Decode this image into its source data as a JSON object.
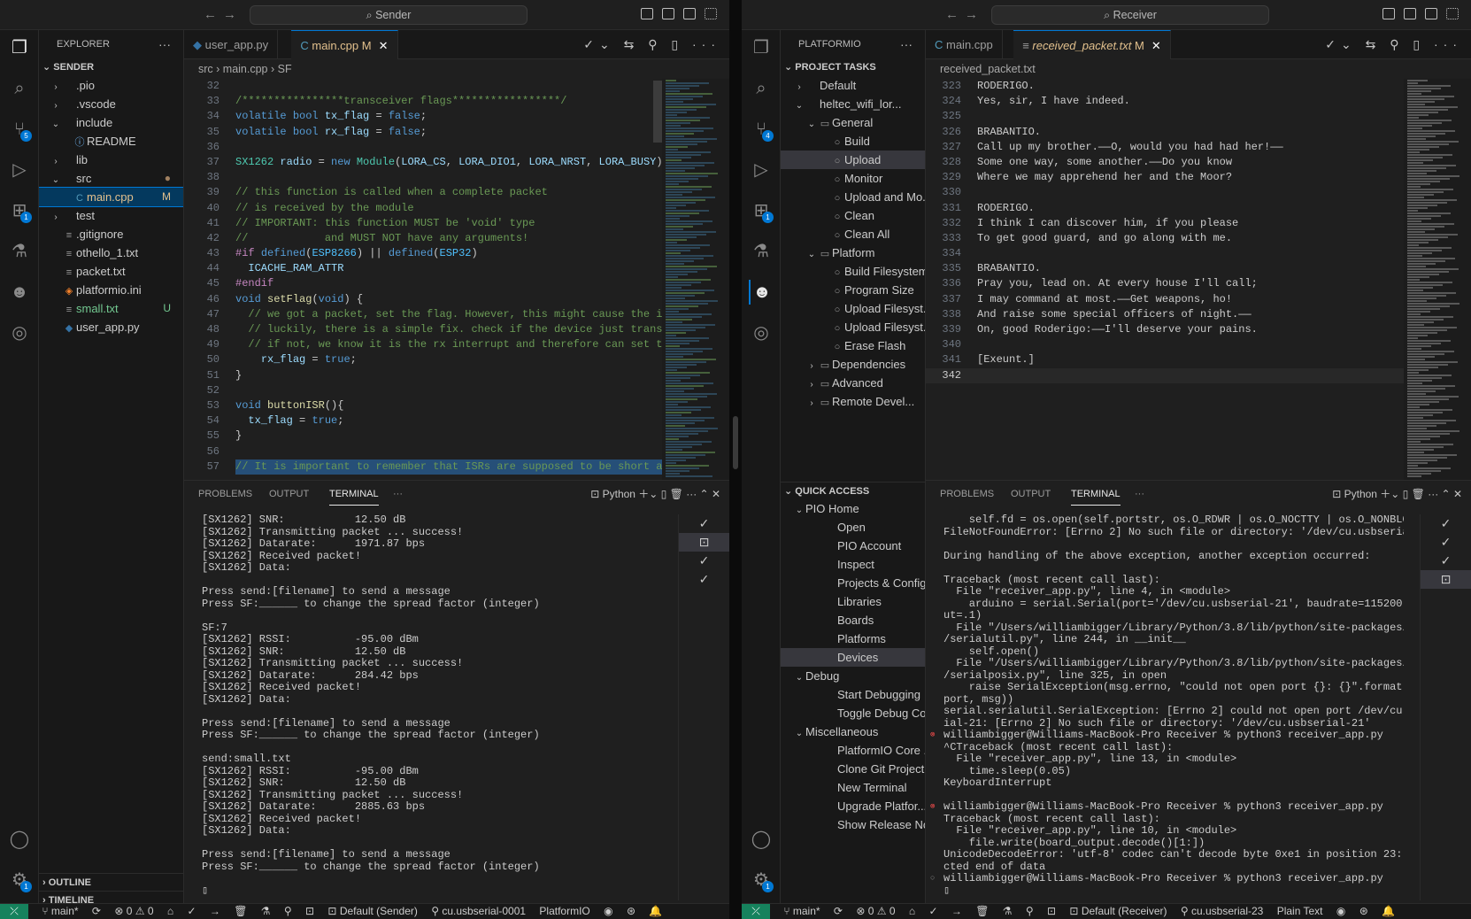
{
  "left": {
    "title": "Sender",
    "explorer_title": "EXPLORER",
    "root": "SENDER",
    "files": [
      {
        "name": ".pio",
        "type": "folder",
        "open": false,
        "indent": 1,
        "status": ""
      },
      {
        "name": ".vscode",
        "type": "folder",
        "open": false,
        "indent": 1,
        "status": ""
      },
      {
        "name": "include",
        "type": "folder",
        "open": true,
        "indent": 1,
        "status": ""
      },
      {
        "name": "README",
        "type": "info",
        "indent": 2,
        "status": ""
      },
      {
        "name": "lib",
        "type": "folder",
        "open": false,
        "indent": 1,
        "status": ""
      },
      {
        "name": "src",
        "type": "folder",
        "open": true,
        "indent": 1,
        "status": "●"
      },
      {
        "name": "main.cpp",
        "type": "cpp",
        "indent": 2,
        "status": "M",
        "selected": true
      },
      {
        "name": "test",
        "type": "folder",
        "open": false,
        "indent": 1,
        "status": ""
      },
      {
        "name": ".gitignore",
        "type": "text",
        "indent": 1,
        "status": ""
      },
      {
        "name": "othello_1.txt",
        "type": "text",
        "indent": 1,
        "status": ""
      },
      {
        "name": "packet.txt",
        "type": "text",
        "indent": 1,
        "status": ""
      },
      {
        "name": "platformio.ini",
        "type": "pio",
        "indent": 1,
        "status": ""
      },
      {
        "name": "small.txt",
        "type": "text",
        "indent": 1,
        "status": "U",
        "green": true
      },
      {
        "name": "user_app.py",
        "type": "py",
        "indent": 1,
        "status": ""
      }
    ],
    "outline": "OUTLINE",
    "timeline": "TIMELINE",
    "tabs": [
      {
        "name": "user_app.py",
        "active": false,
        "mod": ""
      },
      {
        "name": "main.cpp",
        "active": true,
        "mod": "M"
      }
    ],
    "breadcrumb": [
      "src",
      "main.cpp",
      "SF"
    ],
    "code": [
      {
        "n": "32",
        "t": ""
      },
      {
        "n": "33",
        "t": "/****************transceiver flags*****************/"
      },
      {
        "n": "34",
        "t": "volatile bool tx_flag = false;"
      },
      {
        "n": "35",
        "t": "volatile bool rx_flag = false;"
      },
      {
        "n": "36",
        "t": ""
      },
      {
        "n": "37",
        "t": "SX1262 radio = new Module(LORA_CS, LORA_DIO1, LORA_NRST, LORA_BUSY);"
      },
      {
        "n": "38",
        "t": ""
      },
      {
        "n": "39",
        "t": "// this function is called when a complete packet"
      },
      {
        "n": "40",
        "t": "// is received by the module"
      },
      {
        "n": "41",
        "t": "// IMPORTANT: this function MUST be 'void' type"
      },
      {
        "n": "42",
        "t": "//            and MUST NOT have any arguments!"
      },
      {
        "n": "43",
        "t": "#if defined(ESP8266) || defined(ESP32)"
      },
      {
        "n": "44",
        "t": "  ICACHE_RAM_ATTR"
      },
      {
        "n": "45",
        "t": "#endif"
      },
      {
        "n": "46",
        "t": "void setFlag(void) {"
      },
      {
        "n": "47",
        "t": "  // we got a packet, set the flag. However, this might cause the i"
      },
      {
        "n": "48",
        "t": "  // luckily, there is a simple fix. check if the device just trans"
      },
      {
        "n": "49",
        "t": "  // if not, we know it is the rx interrupt and therefore can set t"
      },
      {
        "n": "50",
        "t": "    rx_flag = true;"
      },
      {
        "n": "51",
        "t": "}"
      },
      {
        "n": "52",
        "t": ""
      },
      {
        "n": "53",
        "t": "void buttonISR(){"
      },
      {
        "n": "54",
        "t": "  tx_flag = true;"
      },
      {
        "n": "55",
        "t": "}"
      },
      {
        "n": "56",
        "t": ""
      },
      {
        "n": "57",
        "t": "// It is important to remember that ISRs are supposed to be short a"
      }
    ],
    "panel_tabs": [
      "PROBLEMS",
      "OUTPUT",
      "TERMINAL"
    ],
    "terminal_name": "Python",
    "terminal": [
      "[SX1262] SNR:           12.50 dB",
      "[SX1262] Transmitting packet ... success!",
      "[SX1262] Datarate:      1971.87 bps",
      "[SX1262] Received packet!",
      "[SX1262] Data:",
      "",
      "Press send:[filename] to send a message",
      "Press SF:______ to change the spread factor (integer)",
      "",
      "SF:7",
      "[SX1262] RSSI:          -95.00 dBm",
      "[SX1262] SNR:           12.50 dB",
      "[SX1262] Transmitting packet ... success!",
      "[SX1262] Datarate:      284.42 bps",
      "[SX1262] Received packet!",
      "[SX1262] Data:",
      "",
      "Press send:[filename] to send a message",
      "Press SF:______ to change the spread factor (integer)",
      "",
      "send:small.txt",
      "[SX1262] RSSI:          -95.00 dBm",
      "[SX1262] SNR:           12.50 dB",
      "[SX1262] Transmitting packet ... success!",
      "[SX1262] Datarate:      2885.63 bps",
      "[SX1262] Received packet!",
      "[SX1262] Data:",
      "",
      "Press send:[filename] to send a message",
      "Press SF:______ to change the spread factor (integer)",
      "",
      "▯"
    ],
    "status": {
      "branch": "main*",
      "problems": "⊗ 0 ⚠ 0",
      "env": "Default (Sender)",
      "port": "cu.usbserial-0001",
      "platform": "PlatformIO"
    }
  },
  "right": {
    "title": "Receiver",
    "sidebar_title": "PLATFORMIO",
    "project_tasks": "PROJECT TASKS",
    "tasks": [
      {
        "name": "Default",
        "type": "twisty-closed",
        "indent": 1
      },
      {
        "name": "heltec_wifi_lor...",
        "type": "twisty-open",
        "indent": 1
      },
      {
        "name": "General",
        "type": "folder-open",
        "indent": 2
      },
      {
        "name": "Build",
        "type": "task",
        "indent": 3
      },
      {
        "name": "Upload",
        "type": "task",
        "indent": 3,
        "selected": true
      },
      {
        "name": "Monitor",
        "type": "task",
        "indent": 3
      },
      {
        "name": "Upload and Mo...",
        "type": "task",
        "indent": 3
      },
      {
        "name": "Clean",
        "type": "task",
        "indent": 3
      },
      {
        "name": "Clean All",
        "type": "task",
        "indent": 3
      },
      {
        "name": "Platform",
        "type": "folder-open",
        "indent": 2
      },
      {
        "name": "Build Filesystem...",
        "type": "task",
        "indent": 3
      },
      {
        "name": "Program Size",
        "type": "task",
        "indent": 3
      },
      {
        "name": "Upload Filesyst...",
        "type": "task",
        "indent": 3
      },
      {
        "name": "Upload Filesyst...",
        "type": "task",
        "indent": 3
      },
      {
        "name": "Erase Flash",
        "type": "task",
        "indent": 3
      },
      {
        "name": "Dependencies",
        "type": "folder-closed",
        "indent": 2
      },
      {
        "name": "Advanced",
        "type": "folder-closed",
        "indent": 2
      },
      {
        "name": "Remote Devel...",
        "type": "folder-closed",
        "indent": 2
      }
    ],
    "quick_access": "QUICK ACCESS",
    "quick": [
      {
        "name": "PIO Home",
        "type": "group",
        "indent": 1
      },
      {
        "name": "Open",
        "type": "item",
        "indent": 2
      },
      {
        "name": "PIO Account",
        "type": "item",
        "indent": 2
      },
      {
        "name": "Inspect",
        "type": "item",
        "indent": 2
      },
      {
        "name": "Projects & Config...",
        "type": "item",
        "indent": 2
      },
      {
        "name": "Libraries",
        "type": "item",
        "indent": 2
      },
      {
        "name": "Boards",
        "type": "item",
        "indent": 2
      },
      {
        "name": "Platforms",
        "type": "item",
        "indent": 2
      },
      {
        "name": "Devices",
        "type": "item",
        "indent": 2,
        "selected": true
      },
      {
        "name": "Debug",
        "type": "group",
        "indent": 1
      },
      {
        "name": "Start Debugging",
        "type": "item",
        "indent": 2
      },
      {
        "name": "Toggle Debug Co...",
        "type": "item",
        "indent": 2
      },
      {
        "name": "Miscellaneous",
        "type": "group",
        "indent": 1
      },
      {
        "name": "PlatformIO Core ...",
        "type": "item",
        "indent": 2
      },
      {
        "name": "Clone Git Project",
        "type": "item",
        "indent": 2
      },
      {
        "name": "New Terminal",
        "type": "item",
        "indent": 2
      },
      {
        "name": "Upgrade Platfor...",
        "type": "item",
        "indent": 2
      },
      {
        "name": "Show Release No...",
        "type": "item",
        "indent": 2
      }
    ],
    "tabs": [
      {
        "name": "main.cpp",
        "active": false,
        "mod": ""
      },
      {
        "name": "received_packet.txt",
        "active": true,
        "mod": "M"
      }
    ],
    "breadcrumb": [
      "received_packet.txt"
    ],
    "code": [
      {
        "n": "323",
        "t": "RODERIGO."
      },
      {
        "n": "324",
        "t": "Yes, sir, I have indeed."
      },
      {
        "n": "325",
        "t": ""
      },
      {
        "n": "326",
        "t": "BRABANTIO."
      },
      {
        "n": "327",
        "t": "Call up my brother.——O, would you had had her!——"
      },
      {
        "n": "328",
        "t": "Some one way, some another.——Do you know"
      },
      {
        "n": "329",
        "t": "Where we may apprehend her and the Moor?"
      },
      {
        "n": "330",
        "t": ""
      },
      {
        "n": "331",
        "t": "RODERIGO."
      },
      {
        "n": "332",
        "t": "I think I can discover him, if you please"
      },
      {
        "n": "333",
        "t": "To get good guard, and go along with me."
      },
      {
        "n": "334",
        "t": ""
      },
      {
        "n": "335",
        "t": "BRABANTIO."
      },
      {
        "n": "336",
        "t": "Pray you, lead on. At every house I'll call;"
      },
      {
        "n": "337",
        "t": "I may command at most.——Get weapons, ho!"
      },
      {
        "n": "338",
        "t": "And raise some special officers of night.——"
      },
      {
        "n": "339",
        "t": "On, good Roderigo:——I'll deserve your pains."
      },
      {
        "n": "340",
        "t": ""
      },
      {
        "n": "341",
        "t": "[Exeunt.]"
      },
      {
        "n": "342",
        "t": ""
      }
    ],
    "panel_tabs": [
      "PROBLEMS",
      "OUTPUT",
      "TERMINAL"
    ],
    "terminal_name": "Python",
    "terminal": [
      {
        "t": "    self.fd = os.open(self.portstr, os.O_RDWR | os.O_NOCTTY | os.O_NONBLOCK)",
        "d": ""
      },
      {
        "t": "FileNotFoundError: [Errno 2] No such file or directory: '/dev/cu.usbserial-21'",
        "d": ""
      },
      {
        "t": "",
        "d": ""
      },
      {
        "t": "During handling of the above exception, another exception occurred:",
        "d": ""
      },
      {
        "t": "",
        "d": ""
      },
      {
        "t": "Traceback (most recent call last):",
        "d": ""
      },
      {
        "t": "  File \"receiver_app.py\", line 4, in <module>",
        "d": ""
      },
      {
        "t": "    arduino = serial.Serial(port='/dev/cu.usbserial-21', baudrate=115200, timeo",
        "d": ""
      },
      {
        "t": "ut=.1)",
        "d": ""
      },
      {
        "t": "  File \"/Users/williambigger/Library/Python/3.8/lib/python/site-packages/serial",
        "d": ""
      },
      {
        "t": "/serialutil.py\", line 244, in __init__",
        "d": ""
      },
      {
        "t": "    self.open()",
        "d": ""
      },
      {
        "t": "  File \"/Users/williambigger/Library/Python/3.8/lib/python/site-packages/serial",
        "d": ""
      },
      {
        "t": "/serialposix.py\", line 325, in open",
        "d": ""
      },
      {
        "t": "    raise SerialException(msg.errno, \"could not open port {}: {}\".format(self._",
        "d": ""
      },
      {
        "t": "port, msg))",
        "d": ""
      },
      {
        "t": "serial.serialutil.SerialException: [Errno 2] could not open port /dev/cu.usbser",
        "d": ""
      },
      {
        "t": "ial-21: [Errno 2] No such file or directory: '/dev/cu.usbserial-21'",
        "d": ""
      },
      {
        "t": "williambigger@Williams-MacBook-Pro Receiver % python3 receiver_app.py",
        "d": "err"
      },
      {
        "t": "^CTraceback (most recent call last):",
        "d": ""
      },
      {
        "t": "  File \"receiver_app.py\", line 13, in <module>",
        "d": ""
      },
      {
        "t": "    time.sleep(0.05)",
        "d": ""
      },
      {
        "t": "KeyboardInterrupt",
        "d": ""
      },
      {
        "t": "",
        "d": ""
      },
      {
        "t": "williambigger@Williams-MacBook-Pro Receiver % python3 receiver_app.py",
        "d": "err"
      },
      {
        "t": "Traceback (most recent call last):",
        "d": ""
      },
      {
        "t": "  File \"receiver_app.py\", line 10, in <module>",
        "d": ""
      },
      {
        "t": "    file.write(board_output.decode()[1:])",
        "d": ""
      },
      {
        "t": "UnicodeDecodeError: 'utf-8' codec can't decode byte 0xe1 in position 23: unexpe",
        "d": ""
      },
      {
        "t": "cted end of data",
        "d": ""
      },
      {
        "t": "williambigger@Williams-MacBook-Pro Receiver % python3 receiver_app.py",
        "d": "ok"
      },
      {
        "t": "▯",
        "d": ""
      }
    ],
    "status": {
      "branch": "main*",
      "problems": "⊗ 0 ⚠ 0",
      "env": "Default (Receiver)",
      "port": "cu.usbserial-23",
      "lang": "Plain Text"
    }
  },
  "icons": {
    "explorer": "files-icon",
    "search": "search-icon",
    "scm": "source-control-icon",
    "run": "run-debug-icon",
    "extensions": "extensions-icon",
    "test": "flask-icon",
    "pio": "platformio-alien-icon",
    "remote": "remote-explorer-icon",
    "account": "account-icon",
    "settings": "gear-icon"
  },
  "badges": {
    "left_scm": "5",
    "left_ext": "1",
    "left_gear": "1",
    "right_scm": "4",
    "right_ext": "1",
    "right_gear": "1"
  },
  "colors": {
    "accent": "#0078d4",
    "remote": "#16825d",
    "keyword": "#569cd6",
    "type": "#4ec9b0",
    "comment": "#6a9955",
    "func": "#dcdcaa",
    "preproc": "#c586c0",
    "number": "#b5cea8"
  }
}
